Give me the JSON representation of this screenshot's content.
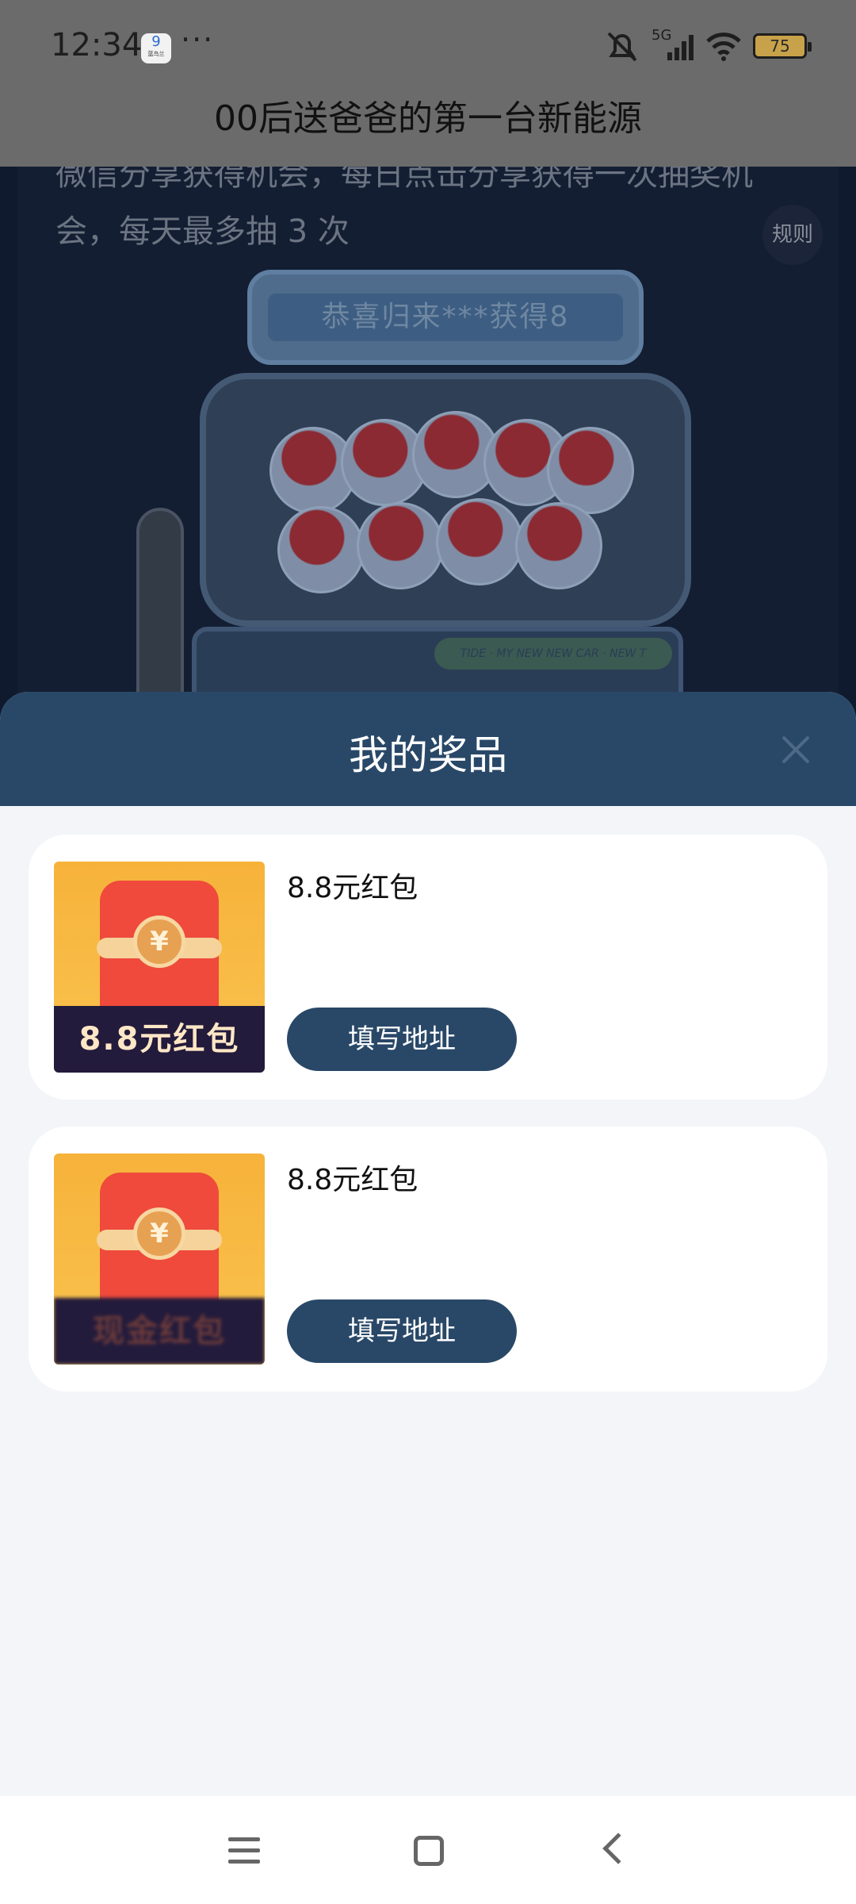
{
  "status_bar": {
    "time": "12:34",
    "app_badge": "9",
    "app_badge_sub": "蓝鸟兰",
    "more": "···",
    "network": "5G",
    "battery": "75"
  },
  "header": {
    "title": "00后送爸爸的第一台新能源"
  },
  "background_page": {
    "intro_line1": "微信分享获得机会，每日点击分享获得一次抽奖机",
    "intro_line2": "会，每天最多抽 3 次",
    "rules_button": "规则",
    "marquee": "恭喜归来***获得8",
    "base_strip": "TIDE · MY NEW NEW CAR · NEW T"
  },
  "prize_sheet": {
    "title": "我的奖品",
    "close_icon": "close-icon",
    "prizes": [
      {
        "name": "8.8元红包",
        "image_label": "8.8元红包",
        "coin": "¥",
        "button": "填写地址"
      },
      {
        "name": "8.8元红包",
        "image_label": "现金红包",
        "coin": "¥",
        "button": "填写地址"
      }
    ]
  },
  "nav": {
    "menu": "menu-icon",
    "home": "home-icon",
    "back": "back-icon"
  },
  "colors": {
    "accent": "#294868",
    "sheet_bg": "#f3f5f9"
  }
}
